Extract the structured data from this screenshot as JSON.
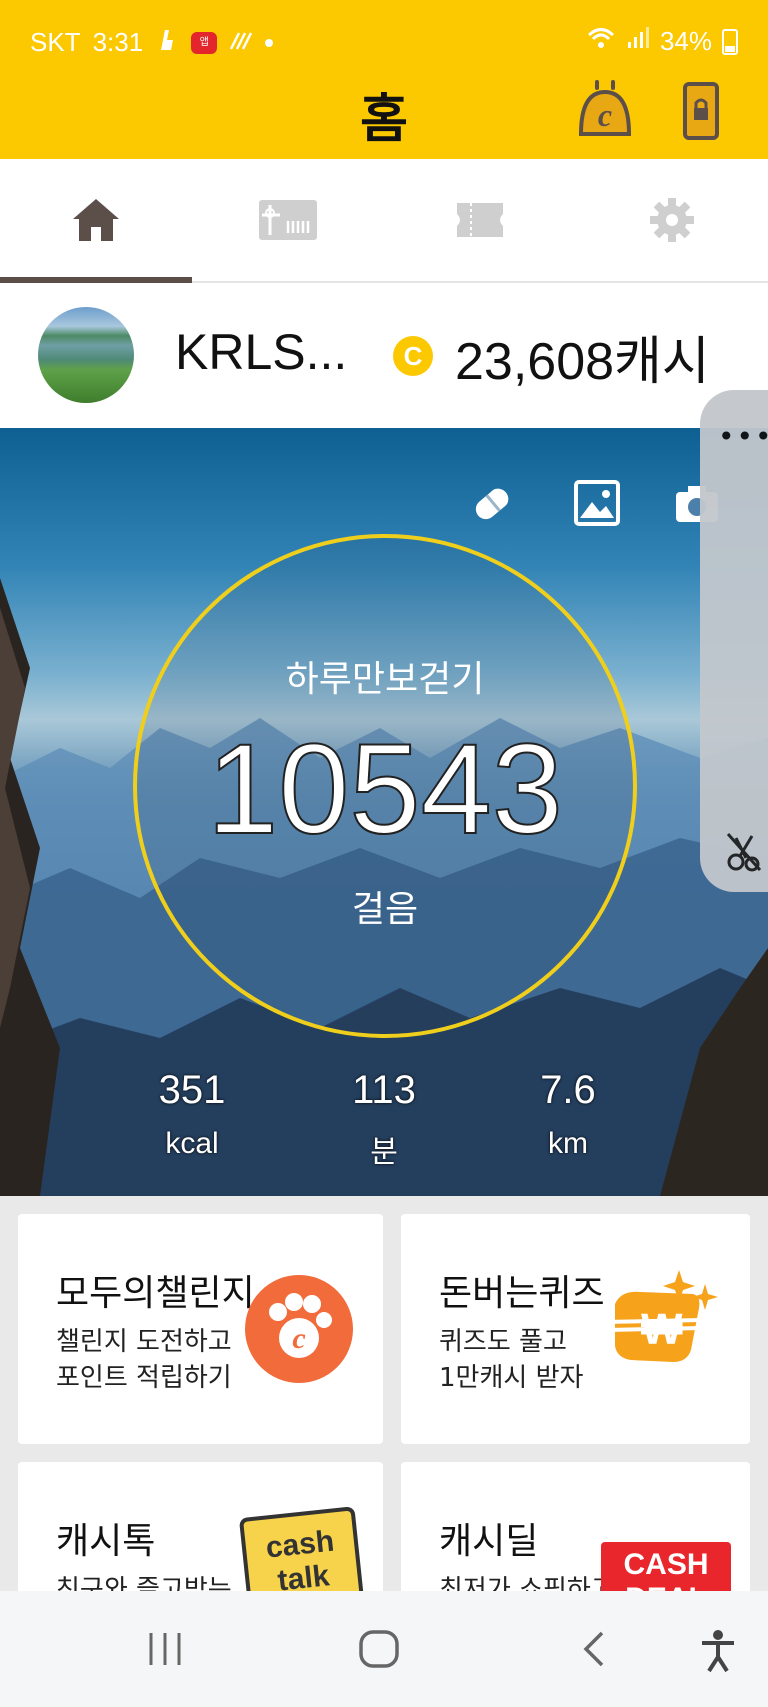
{
  "status_bar": {
    "carrier": "SKT",
    "time": "3:31",
    "notif_badge": "앱",
    "battery": "34%"
  },
  "header": {
    "title": "홈",
    "cash_icon": "cash-c-icon",
    "lock_icon": "phone-lock-icon"
  },
  "tabs": [
    {
      "name": "home",
      "icon": "home-icon",
      "active": true
    },
    {
      "name": "gift",
      "icon": "gift-card-icon",
      "active": false
    },
    {
      "name": "coupon",
      "icon": "ticket-icon",
      "active": false
    },
    {
      "name": "settings",
      "icon": "gear-icon",
      "active": false
    }
  ],
  "profile": {
    "username": "KRLS...",
    "coin_symbol": "C",
    "cash": "23,608캐시"
  },
  "hero": {
    "icons": [
      "pill-icon",
      "image-icon",
      "camera-icon"
    ],
    "label_top": "하루만보걷기",
    "steps": "10543",
    "label_bottom": "걸음",
    "stats": [
      {
        "value": "351",
        "unit": "kcal"
      },
      {
        "value": "113",
        "unit": "분"
      },
      {
        "value": "7.6",
        "unit": "km"
      }
    ]
  },
  "side_panel": {
    "more": "•••",
    "icon": "scissors-off-icon"
  },
  "cards": [
    {
      "title": "모두의챌린지",
      "sub1": "챌린지 도전하고",
      "sub2": "포인트 적립하기",
      "icon": "paw-coin-icon"
    },
    {
      "title": "돈버는퀴즈",
      "sub1": "퀴즈도 풀고",
      "sub2": "1만캐시 받자",
      "icon": "won-sparkle-icon"
    },
    {
      "title": "캐시톡",
      "sub1": "친구와 즐고받는",
      "sub2": "",
      "icon": "cashtalk-logo",
      "logo_text1": "cash",
      "logo_text2": "talk"
    },
    {
      "title": "캐시딜",
      "sub1": "최저가 쇼핑하고",
      "sub2": "",
      "icon": "cashdeal-logo",
      "logo_text1": "CASH",
      "logo_text2": "DEAL"
    }
  ],
  "navbar": {
    "recent": "recent-apps-icon",
    "home": "home-circle-icon",
    "back": "back-icon",
    "accessibility": "accessibility-icon"
  },
  "colors": {
    "brand_yellow": "#fcc800",
    "ring": "#f0cf1c",
    "challenge_orange": "#f26b3a",
    "quiz_orange": "#f7a21b",
    "deal_red": "#e8262b"
  }
}
